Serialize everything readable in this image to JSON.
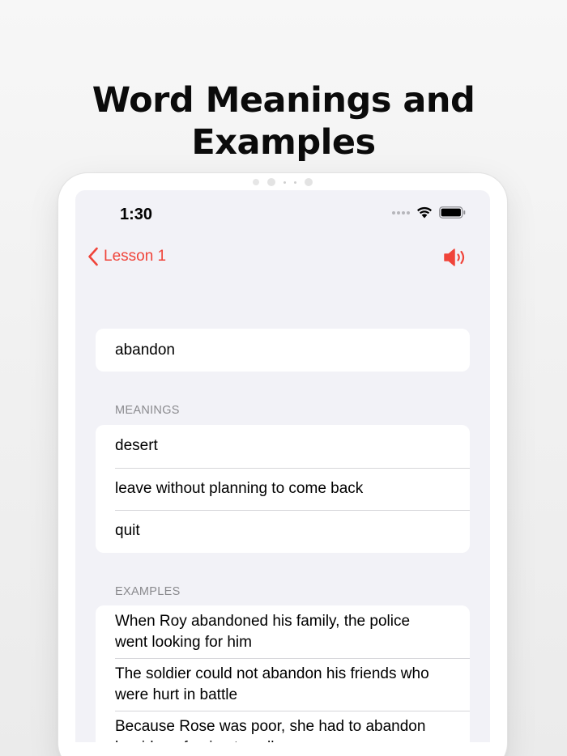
{
  "promo": {
    "title_line1": "Word Meanings and",
    "title_line2": "Examples"
  },
  "status_bar": {
    "time": "1:30",
    "icons": [
      "cellular-dots-icon",
      "wifi-icon",
      "battery-icon"
    ]
  },
  "nav": {
    "back_label": "Lesson 1",
    "back_icon": "chevron-left-icon",
    "speaker_icon": "speaker-icon",
    "accent_color": "#f0443a"
  },
  "word": "abandon",
  "meanings": {
    "header": "MEANINGS",
    "items": [
      "desert",
      "leave without planning to come back",
      "quit"
    ]
  },
  "examples": {
    "header": "EXAMPLES",
    "items": [
      "When Roy abandoned his family, the police went looking for him",
      "The soldier could not abandon his friends who were hurt in battle",
      "Because Rose was poor, she had to abandon her idea of going to college"
    ]
  }
}
